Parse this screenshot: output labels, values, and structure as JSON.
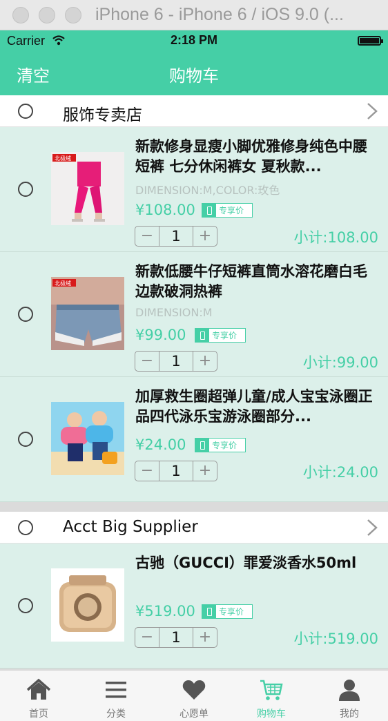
{
  "window": {
    "title": "iPhone 6 - iPhone 6 / iOS 9.0 (..."
  },
  "status_bar": {
    "carrier": "Carrier",
    "time": "2:18 PM"
  },
  "nav": {
    "left_action": "清空",
    "title": "购物车"
  },
  "colors": {
    "accent": "#45cfa6",
    "item_bg": "#dcf0ea",
    "spec_text": "#b7c2bf"
  },
  "shops": [
    {
      "name": "服饰专卖店",
      "items": [
        {
          "title": "新款修身显瘦小脚优雅修身纯色中腰短裤 七分休闲裤女 夏秋款...",
          "spec": "DIMENSION:M,COLOR:玫色",
          "price": "¥108.00",
          "badge": "专享价",
          "quantity": "1",
          "subtotal": "小计:108.00",
          "image": "pink-pants-photo",
          "logo": "北极绒"
        },
        {
          "title": "新款低腰牛仔短裤直筒水溶花磨白毛边款破洞热裤",
          "spec": "DIMENSION:M",
          "price": "¥99.00",
          "badge": "专享价",
          "quantity": "1",
          "subtotal": "小计:99.00",
          "image": "denim-shorts-photo",
          "logo": "北极绒"
        },
        {
          "title": "加厚救生圈超弹儿童/成人宝宝泳圈正品四代泳乐宝游泳圈部分...",
          "spec": "",
          "price": "¥24.00",
          "badge": "专享价",
          "quantity": "1",
          "subtotal": "小计:24.00",
          "image": "kids-swim-vest-photo"
        }
      ]
    },
    {
      "name": "Acct Big Supplier",
      "items": [
        {
          "title": "古驰（GUCCI）罪爱淡香水50ml",
          "spec": "",
          "price": "¥519.00",
          "badge": "专享价",
          "quantity": "1",
          "subtotal": "小计:519.00",
          "image": "perfume-bottle-photo"
        }
      ]
    }
  ],
  "stepper": {
    "minus": "−",
    "plus": "+"
  },
  "tabs": [
    {
      "label": "首页",
      "icon": "home-icon"
    },
    {
      "label": "分类",
      "icon": "list-icon"
    },
    {
      "label": "心愿单",
      "icon": "heart-icon"
    },
    {
      "label": "购物车",
      "icon": "cart-icon",
      "active": true
    },
    {
      "label": "我的",
      "icon": "user-icon"
    }
  ]
}
